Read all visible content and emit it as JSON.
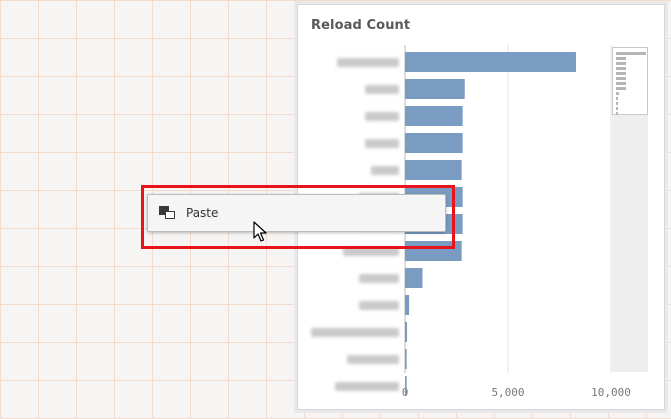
{
  "chart_data": {
    "type": "bar",
    "orientation": "horizontal",
    "title": "Reload Count",
    "categories": [
      "",
      "",
      "",
      "",
      "",
      "",
      "",
      "",
      "",
      "",
      "",
      "",
      ""
    ],
    "values": [
      8300,
      2900,
      2800,
      2800,
      2750,
      2800,
      2800,
      2750,
      850,
      200,
      100,
      80,
      80
    ],
    "xlim": [
      0,
      10000
    ],
    "ticks": [
      0,
      5000,
      10000
    ],
    "tick_labels": [
      "0",
      "5,000",
      "10,000"
    ],
    "grid": true,
    "bar_color": "#7a9cc2",
    "category_labels_obscured": true
  },
  "context_menu": {
    "items": [
      {
        "label": "Paste",
        "icon": "paste-icon"
      }
    ]
  },
  "colors": {
    "highlight": "#e8141b",
    "grid_background": "#f3dccb",
    "bar": "#7a9cc2"
  }
}
